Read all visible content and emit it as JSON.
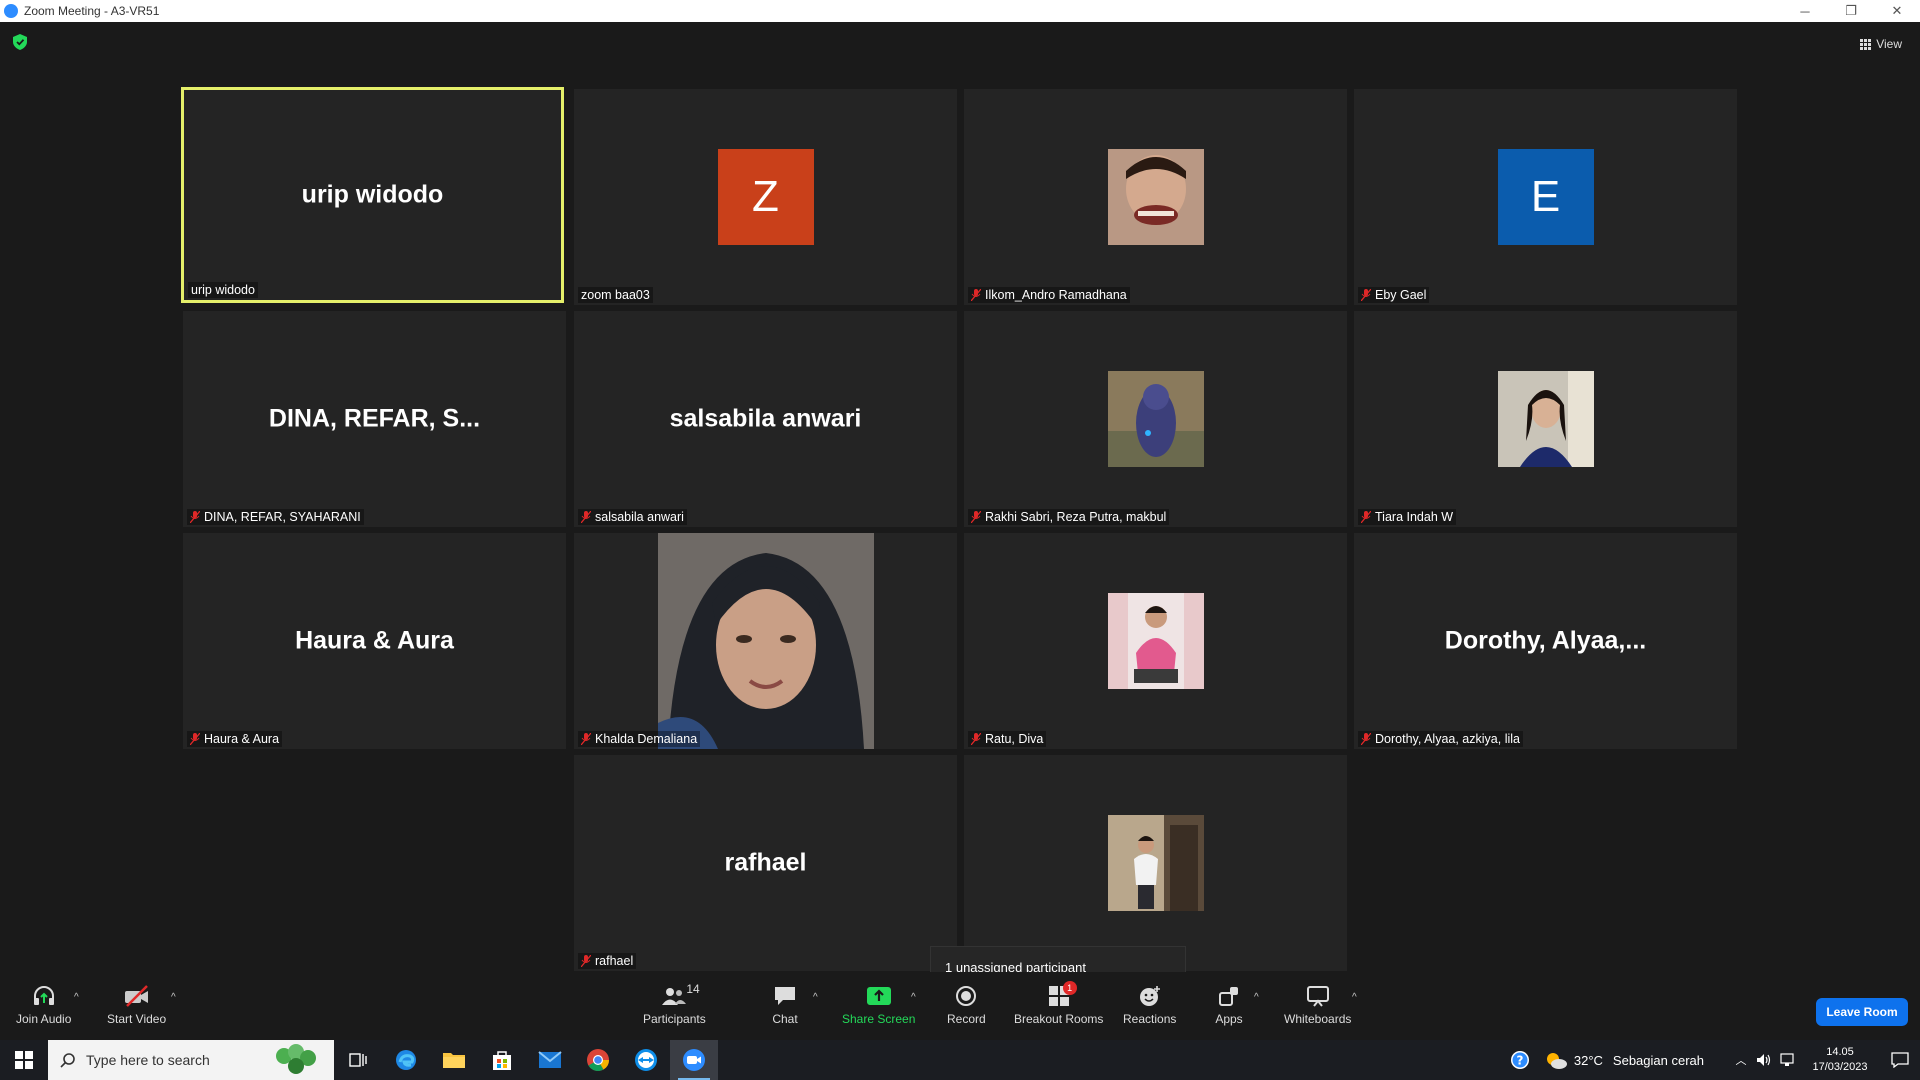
{
  "window": {
    "title": "Zoom Meeting - A3-VR51",
    "minimize": "─",
    "restore": "❐",
    "close": "✕"
  },
  "view_button": {
    "label": "View"
  },
  "tiles": [
    {
      "name": "urip widodo",
      "display": "urip widodo",
      "kind": "name",
      "muted": false,
      "active": true
    },
    {
      "name": "zoom baa03",
      "display": "Z",
      "kind": "avatar",
      "color": "#c9401a",
      "muted": false,
      "active": false
    },
    {
      "name": "Ilkom_Andro Ramadhana",
      "display": "",
      "kind": "photo",
      "muted": true,
      "active": false
    },
    {
      "name": "Eby Gael",
      "display": "E",
      "kind": "avatar",
      "color": "#0b5cad",
      "muted": true,
      "active": false
    },
    {
      "name": "DINA, REFAR, SYAHARANI",
      "display": "DINA, REFAR, S...",
      "kind": "name",
      "muted": true,
      "active": false
    },
    {
      "name": "salsabila anwari",
      "display": "salsabila anwari",
      "kind": "name",
      "muted": true,
      "active": false
    },
    {
      "name": "Rakhi Sabri, Reza Putra, makbul",
      "display": "",
      "kind": "photo",
      "muted": true,
      "active": false
    },
    {
      "name": "Tiara Indah W",
      "display": "",
      "kind": "photo",
      "muted": true,
      "active": false
    },
    {
      "name": "Haura & Aura",
      "display": "Haura & Aura",
      "kind": "name",
      "muted": true,
      "active": false
    },
    {
      "name": "Khalda Demaliana",
      "display": "",
      "kind": "video",
      "muted": true,
      "active": false
    },
    {
      "name": "Ratu, Diva",
      "display": "",
      "kind": "photo",
      "muted": true,
      "active": false
    },
    {
      "name": "Dorothy, Alyaa, azkiya, lila",
      "display": "Dorothy,  Alyaa,...",
      "kind": "name",
      "muted": true,
      "active": false
    },
    {
      "name": "rafhael",
      "display": "rafhael",
      "kind": "name",
      "muted": true,
      "active": false
    },
    {
      "name": "",
      "display": "",
      "kind": "photo",
      "muted": false,
      "active": false
    }
  ],
  "tooltip": {
    "text": "1 unassigned participant"
  },
  "toolbar": {
    "join_audio": "Join Audio",
    "start_video": "Start Video",
    "participants": "Participants",
    "participants_count": "14",
    "chat": "Chat",
    "share_screen": "Share Screen",
    "record": "Record",
    "breakout_rooms": "Breakout Rooms",
    "breakout_badge": "1",
    "reactions": "Reactions",
    "apps": "Apps",
    "whiteboards": "Whiteboards",
    "leave_room": "Leave Room",
    "caret": "^"
  },
  "taskbar": {
    "search_placeholder": "Type here to search",
    "weather_temp": "32°C",
    "weather_desc": "Sebagian cerah",
    "time": "14.05",
    "date": "17/03/2023"
  },
  "colors": {
    "accent": "#0e72ed",
    "active_border": "#e5ef6a",
    "share_green": "#23d959",
    "mute_red": "#e02828"
  }
}
